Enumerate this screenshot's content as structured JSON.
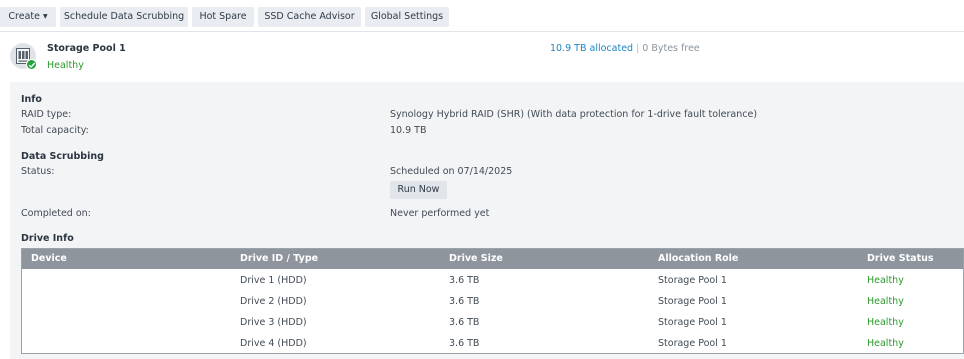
{
  "toolbar": {
    "create_label": "Create",
    "scrubbing_label": "Schedule Data Scrubbing",
    "hot_spare_label": "Hot Spare",
    "ssd_label": "SSD Cache Advisor",
    "global_label": "Global Settings"
  },
  "pool": {
    "name": "Storage Pool 1",
    "status": "Healthy",
    "allocated": "10.9 TB allocated",
    "separator": "|",
    "free": "0 Bytes free"
  },
  "info": {
    "title": "Info",
    "raid_label": "RAID type:",
    "raid_value": "Synology Hybrid RAID (SHR) (With data protection for 1-drive fault tolerance)",
    "capacity_label": "Total capacity:",
    "capacity_value": "10.9 TB"
  },
  "scrubbing": {
    "title": "Data Scrubbing",
    "status_label": "Status:",
    "status_value": "Scheduled on 07/14/2025",
    "run_now_label": "Run Now",
    "completed_label": "Completed on:",
    "completed_value": "Never performed yet"
  },
  "drive_info": {
    "title": "Drive Info",
    "columns": [
      "Device",
      "Drive ID / Type",
      "Drive Size",
      "Allocation Role",
      "Drive Status"
    ],
    "rows": [
      {
        "device": "",
        "drive_id": "Drive 1 (HDD)",
        "size": "3.6 TB",
        "role": "Storage Pool 1",
        "status": "Healthy"
      },
      {
        "device": "",
        "drive_id": "Drive 2 (HDD)",
        "size": "3.6 TB",
        "role": "Storage Pool 1",
        "status": "Healthy"
      },
      {
        "device": "",
        "drive_id": "Drive 3 (HDD)",
        "size": "3.6 TB",
        "role": "Storage Pool 1",
        "status": "Healthy"
      },
      {
        "device": "",
        "drive_id": "Drive 4 (HDD)",
        "size": "3.6 TB",
        "role": "Storage Pool 1",
        "status": "Healthy"
      }
    ]
  },
  "colors": {
    "healthy": "#2b9a2b",
    "link": "#1f84c4",
    "table_header": "#8e959d",
    "panel_bg": "#f2f4f6"
  }
}
